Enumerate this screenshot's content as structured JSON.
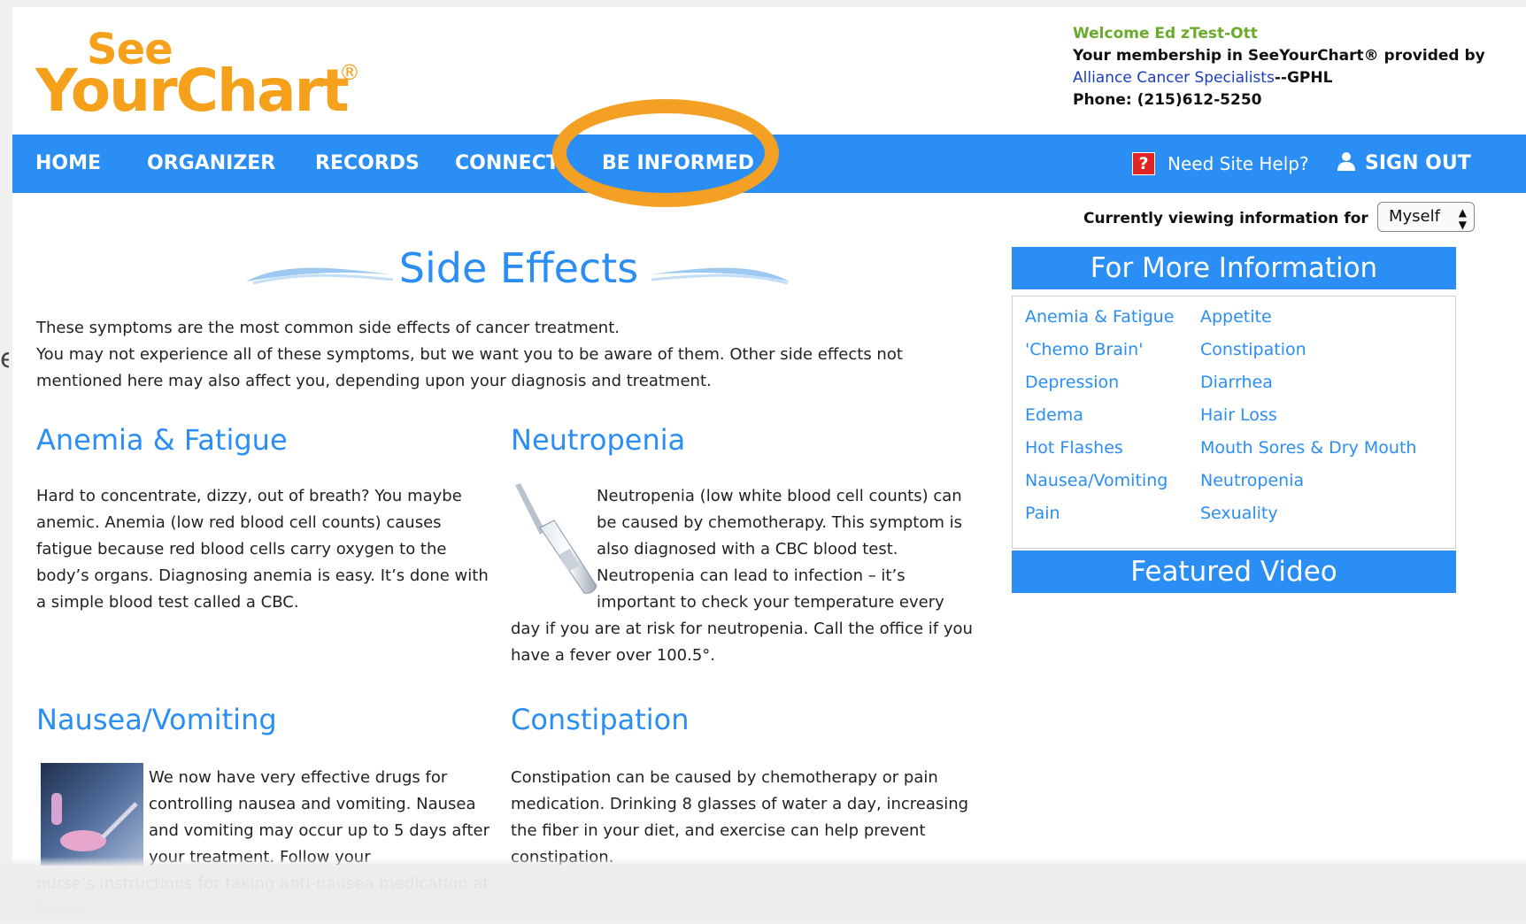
{
  "logo": {
    "line1": "See",
    "line2": "YourChart",
    "reg": "®"
  },
  "welcome": {
    "greeting": "Welcome Ed zTest-Ott",
    "membership": "Your membership in SeeYourChart® provided by",
    "provider_link": "Alliance Cancer Specialists",
    "provider_suffix": "--GPHL",
    "phone": "Phone: (215)612-5250"
  },
  "nav": {
    "items": [
      "HOME",
      "ORGANIZER",
      "RECORDS",
      "CONNECT",
      "BE INFORMED"
    ],
    "help": "Need Site Help?",
    "signout": "SIGN OUT"
  },
  "viewing": {
    "label": "Currently viewing information for",
    "selected": "Myself"
  },
  "page": {
    "title": "Side Effects",
    "intro_line1": "These symptoms are the most common side effects of cancer treatment.",
    "intro_line2": "You may not experience all of these symptoms, but we want you to be aware of them. Other side effects not mentioned here may also affect you, depending upon your diagnosis and treatment."
  },
  "sections": {
    "anemia": {
      "title": "Anemia & Fatigue",
      "text": "Hard to concentrate, dizzy, out of breath? You maybe anemic. Anemia (low red blood cell counts) causes fatigue because red blood cells carry oxygen to the body’s organs. Diagnosing anemia is easy. It’s done with a simple blood test called a CBC."
    },
    "neutropenia": {
      "title": "Neutropenia",
      "text_top": "Neutropenia (low white blood cell counts) can be caused by chemotherapy. This symptom is also diagnosed with a CBC blood test. Neutropenia can lead to infection – it’s important to check your temperature every",
      "text_bottom": "day if you are at risk for neutropenia. Call the office if you have a fever over 100.5°."
    },
    "nausea": {
      "title": "Nausea/Vomiting",
      "text_top": "We now have very effective drugs for controlling nausea and vomiting. Nausea and vomiting may occur up to 5 days after your treatment. Follow your",
      "text_bottom": "nurse’s instructions for taking anti-nausea medication at home."
    },
    "constipation": {
      "title": "Constipation",
      "text": "Constipation can be caused by chemotherapy or pain medication. Drinking 8 glasses of water a day, increasing the fiber in your diet, and exercise can help prevent constipation."
    }
  },
  "sidebar": {
    "more_info_title": "For More Information",
    "links_left": [
      "Anemia & Fatigue",
      "'Chemo Brain'",
      "Depression",
      "Edema",
      "Hot Flashes",
      "Nausea/Vomiting",
      "Pain"
    ],
    "links_right": [
      "Appetite",
      "Constipation",
      "Diarrhea",
      "Hair Loss",
      "Mouth Sores & Dry Mouth",
      "Neutropenia",
      "Sexuality"
    ],
    "video_title": "Featured Video"
  },
  "colors": {
    "brand_blue": "#2a8ef4",
    "brand_orange": "#f5a11c",
    "welcome_green": "#6aab2c",
    "highlight_orange": "#f4a024"
  }
}
